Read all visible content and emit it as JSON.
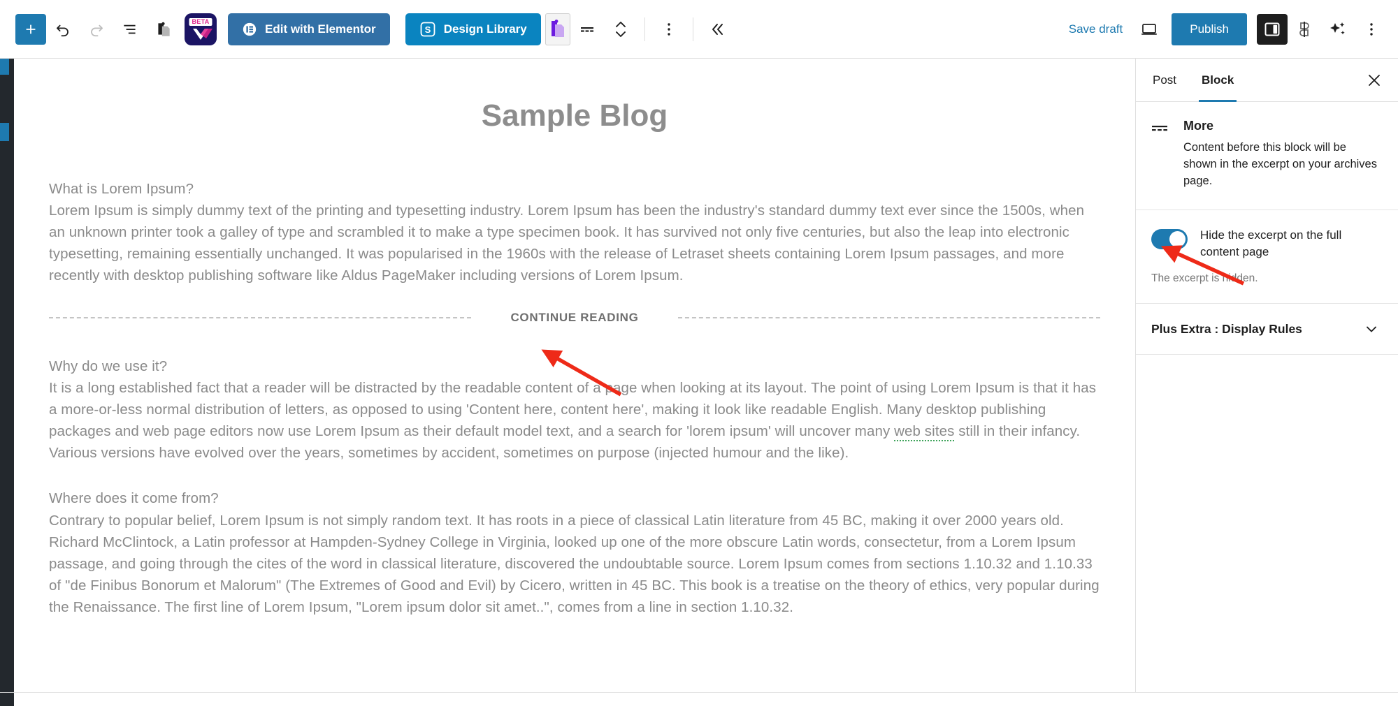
{
  "toolbar": {
    "add_block_label": "+",
    "undo_label": "Undo",
    "redo_label": "Redo",
    "list_view_label": "Document Overview",
    "paste_label": "Copy / Paste",
    "beta_badge": "BETA",
    "beta_label": "WPBakery Beta",
    "elementor_label": "Edit with Elementor",
    "design_library_label": "Design Library",
    "stackable_label": "Stackable",
    "more_block_label": "More",
    "move_label": "Move up or down",
    "options_label": "Options",
    "collapse_label": "Collapse sidebar",
    "save_draft_label": "Save draft",
    "preview_label": "Preview",
    "publish_label": "Publish",
    "settings_label": "Settings",
    "jetpack_label": "Jetpack",
    "ai_label": "AI Assistant",
    "kebab_label": "Options",
    "accent_blue": "#1e7ab0",
    "elementor_blue": "#3270a6",
    "design_blue": "#0a84c0",
    "beta_navy": "#1b1464"
  },
  "editor": {
    "post_title": "Sample Blog",
    "blocks": [
      {
        "type": "paragraph",
        "text": "What is Lorem Ipsum?\nLorem Ipsum is simply dummy text of the printing and typesetting industry. Lorem Ipsum has been the industry's standard dummy text ever since the 1500s, when an unknown printer took a galley of type and scrambled it to make a type specimen book. It has survived not only five centuries, but also the leap into electronic typesetting, remaining essentially unchanged. It was popularised in the 1960s with the release of Letraset sheets containing Lorem Ipsum passages, and more recently with desktop publishing software like Aldus PageMaker including versions of Lorem Ipsum."
      },
      {
        "type": "more",
        "label": "CONTINUE READING"
      },
      {
        "type": "paragraph",
        "text": "Why do we use it?\nIt is a long established fact that a reader will be distracted by the readable content of a page when looking at its layout. The point of using Lorem Ipsum is that it has a more-or-less normal distribution of letters, as opposed to using 'Content here, content here', making it look like readable English. Many desktop publishing packages and web page editors now use Lorem Ipsum as their default model text, and a search for 'lorem ipsum' will uncover many web sites still in their infancy. Various versions have evolved over the years, sometimes by accident, sometimes on purpose (injected humour and the like)."
      },
      {
        "type": "paragraph",
        "text": "Where does it come from?\nContrary to popular belief, Lorem Ipsum is not simply random text. It has roots in a piece of classical Latin literature from 45 BC, making it over 2000 years old. Richard McClintock, a Latin professor at Hampden-Sydney College in Virginia, looked up one of the more obscure Latin words, consectetur, from a Lorem Ipsum passage, and going through the cites of the word in classical literature, discovered the undoubtable source. Lorem Ipsum comes from sections 1.10.32 and 1.10.33 of \"de Finibus Bonorum et Malorum\" (The Extremes of Good and Evil) by Cicero, written in 45 BC. This book is a treatise on the theory of ethics, very popular during the Renaissance. The first line of Lorem Ipsum, \"Lorem ipsum dolor sit amet..\", comes from a line in section 1.10.32."
      }
    ],
    "paragraph_1_head": "What is Lorem Ipsum?",
    "paragraph_1_body": "Lorem Ipsum is simply dummy text of the printing and typesetting industry. Lorem Ipsum has been the industry's standard dummy text ever since the 1500s, when an unknown printer took a galley of type and scrambled it to make a type specimen book. It has survived not only five centuries, but also the leap into electronic typesetting, remaining essentially unchanged. It was popularised in the 1960s with the release of Letraset sheets containing Lorem Ipsum passages, and more recently with desktop publishing software like Aldus PageMaker including versions of Lorem Ipsum.",
    "more_label": "CONTINUE READING",
    "paragraph_2_head": "Why do we use it?",
    "paragraph_2_body_a": "It is a long established fact that a reader will be distracted by the readable content of a page when looking at its layout. The point of using Lorem Ipsum is that it has a more-or-less normal distribution of letters, as opposed to using 'Content here, content here', making it look like readable English. Many desktop publishing packages and web page editors now use Lorem Ipsum as their default model text, and a search for 'lorem ipsum' will uncover many ",
    "paragraph_2_misspelled": "web sites",
    "paragraph_2_body_b": " still in their infancy. Various versions have evolved over the years, sometimes by accident, sometimes on purpose (injected humour and the like).",
    "paragraph_3_head": "Where does it come from?",
    "paragraph_3_body": "Contrary to popular belief, Lorem Ipsum is not simply random text. It has roots in a piece of classical Latin literature from 45 BC, making it over 2000 years old. Richard McClintock, a Latin professor at Hampden-Sydney College in Virginia, looked up one of the more obscure Latin words, consectetur, from a Lorem Ipsum passage, and going through the cites of the word in classical literature, discovered the undoubtable source. Lorem Ipsum comes from sections 1.10.32 and 1.10.33 of \"de Finibus Bonorum et Malorum\" (The Extremes of Good and Evil) by Cicero, written in 45 BC. This book is a treatise on the theory of ethics, very popular during the Renaissance. The first line of Lorem Ipsum, \"Lorem ipsum dolor sit amet..\", comes from a line in section 1.10.32."
  },
  "sidebar": {
    "tabs": [
      {
        "label": "Post",
        "active": false
      },
      {
        "label": "Block",
        "active": true
      }
    ],
    "close_label": "Close settings",
    "block": {
      "icon": "more-block-icon",
      "name": "More",
      "description": "Content before this block will be shown in the excerpt on your archives page."
    },
    "toggle": {
      "label": "Hide the excerpt on the full content page",
      "state": "on",
      "help": "The excerpt is hidden."
    },
    "panels": [
      {
        "title": "Plus Extra : Display Rules",
        "expanded": false
      }
    ]
  },
  "annotations": [
    {
      "name": "arrow-to-continue-reading",
      "color": "#ee2a18",
      "points_to": "CONTINUE READING"
    },
    {
      "name": "arrow-to-hide-excerpt-toggle",
      "color": "#ee2a18",
      "points_to": "Hide the excerpt on the full content page toggle"
    }
  ]
}
